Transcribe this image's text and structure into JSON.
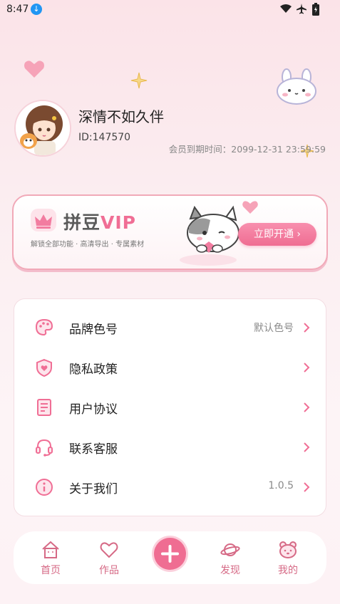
{
  "status_bar": {
    "time": "8:47"
  },
  "profile": {
    "nickname": "深情不如久伴",
    "user_id": "ID:147570",
    "expire_text": "会员到期时间：2099-12-31 23:59:59"
  },
  "vip": {
    "title_main": "拼豆",
    "title_vip": "VIP",
    "subtitle": "解锁全部功能 · 高清导出 · 专属素材",
    "button_label": "立即开通 ›"
  },
  "menu": {
    "items": [
      {
        "label": "品牌色号",
        "value": "默认色号",
        "icon": "palette-icon"
      },
      {
        "label": "隐私政策",
        "value": "",
        "icon": "shield-heart-icon"
      },
      {
        "label": "用户协议",
        "value": "",
        "icon": "document-icon"
      },
      {
        "label": "联系客服",
        "value": "",
        "icon": "headset-icon"
      },
      {
        "label": "关于我们",
        "value": "1.0.5",
        "icon": "info-icon"
      }
    ]
  },
  "tabs": [
    {
      "label": "首页",
      "icon": "house-icon"
    },
    {
      "label": "作品",
      "icon": "heart-icon"
    },
    {
      "label": "",
      "icon": "plus-icon"
    },
    {
      "label": "发现",
      "icon": "planet-icon"
    },
    {
      "label": "我的",
      "icon": "bear-icon"
    }
  ],
  "colors": {
    "accent": "#ef6d92",
    "tab_text": "#d66a86",
    "background": "#fbe3e8"
  }
}
